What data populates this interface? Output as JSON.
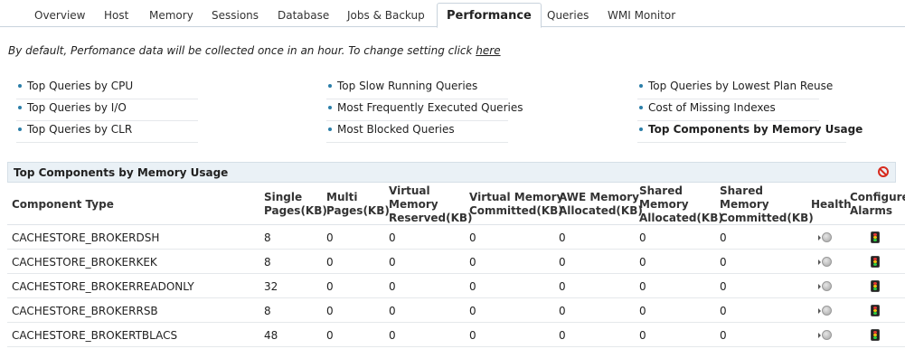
{
  "tabs": [
    {
      "label": "Overview",
      "active": false
    },
    {
      "label": "Host",
      "active": false
    },
    {
      "label": "Memory",
      "active": false
    },
    {
      "label": "Sessions",
      "active": false
    },
    {
      "label": "Database",
      "active": false
    },
    {
      "label": "Jobs & Backup",
      "active": false
    },
    {
      "label": "Performance",
      "active": true
    },
    {
      "label": "Queries",
      "active": false
    },
    {
      "label": "WMI Monitor",
      "active": false
    }
  ],
  "info": {
    "text": "By default, Perfomance data will be collected once in an hour. To change setting click ",
    "link": "here"
  },
  "links": {
    "col1": [
      "Top Queries by CPU",
      "Top Queries by I/O",
      "Top Queries by CLR"
    ],
    "col2": [
      "Top Slow Running Queries",
      "Most Frequently Executed Queries",
      "Most Blocked Queries"
    ],
    "col3": [
      "Top Queries by Lowest Plan Reuse",
      "Cost of Missing Indexes",
      "Top Components by Memory Usage"
    ]
  },
  "panel": {
    "title": "Top Components by Memory Usage",
    "close_icon": "no-entry-icon",
    "accent_color": "#d72b1e"
  },
  "table": {
    "headers": {
      "component_type": "Component Type",
      "single_pages_1": "Single",
      "single_pages_2": "Pages(KB)",
      "multi_pages_1": "Multi",
      "multi_pages_2": "Pages(KB)",
      "vm_reserved_1": "Virtual",
      "vm_reserved_2": "Memory",
      "vm_reserved_3": "Reserved(KB)",
      "vm_committed_1": "Virtual Memory",
      "vm_committed_2": "Committed(KB)",
      "awe_1": "AWE Memory",
      "awe_2": "Allocated(KB)",
      "shared_alloc_1": "Shared",
      "shared_alloc_2": "Memory",
      "shared_alloc_3": "Allocated(KB)",
      "shared_comm_1": "Shared",
      "shared_comm_2": "Memory",
      "shared_comm_3": "Committed(KB)",
      "health": "Health",
      "configure_1": "Configure",
      "configure_2": "Alarms"
    },
    "rows": [
      {
        "component": "CACHESTORE_BROKERDSH",
        "single": "8",
        "multi": "0",
        "vm_reserved": "0",
        "vm_committed": "0",
        "awe": "0",
        "shared_alloc": "0",
        "shared_comm": "0"
      },
      {
        "component": "CACHESTORE_BROKERKEK",
        "single": "8",
        "multi": "0",
        "vm_reserved": "0",
        "vm_committed": "0",
        "awe": "0",
        "shared_alloc": "0",
        "shared_comm": "0"
      },
      {
        "component": "CACHESTORE_BROKERREADONLY",
        "single": "32",
        "multi": "0",
        "vm_reserved": "0",
        "vm_committed": "0",
        "awe": "0",
        "shared_alloc": "0",
        "shared_comm": "0"
      },
      {
        "component": "CACHESTORE_BROKERRSB",
        "single": "8",
        "multi": "0",
        "vm_reserved": "0",
        "vm_committed": "0",
        "awe": "0",
        "shared_alloc": "0",
        "shared_comm": "0"
      },
      {
        "component": "CACHESTORE_BROKERTBLACS",
        "single": "48",
        "multi": "0",
        "vm_reserved": "0",
        "vm_committed": "0",
        "awe": "0",
        "shared_alloc": "0",
        "shared_comm": "0"
      }
    ]
  }
}
